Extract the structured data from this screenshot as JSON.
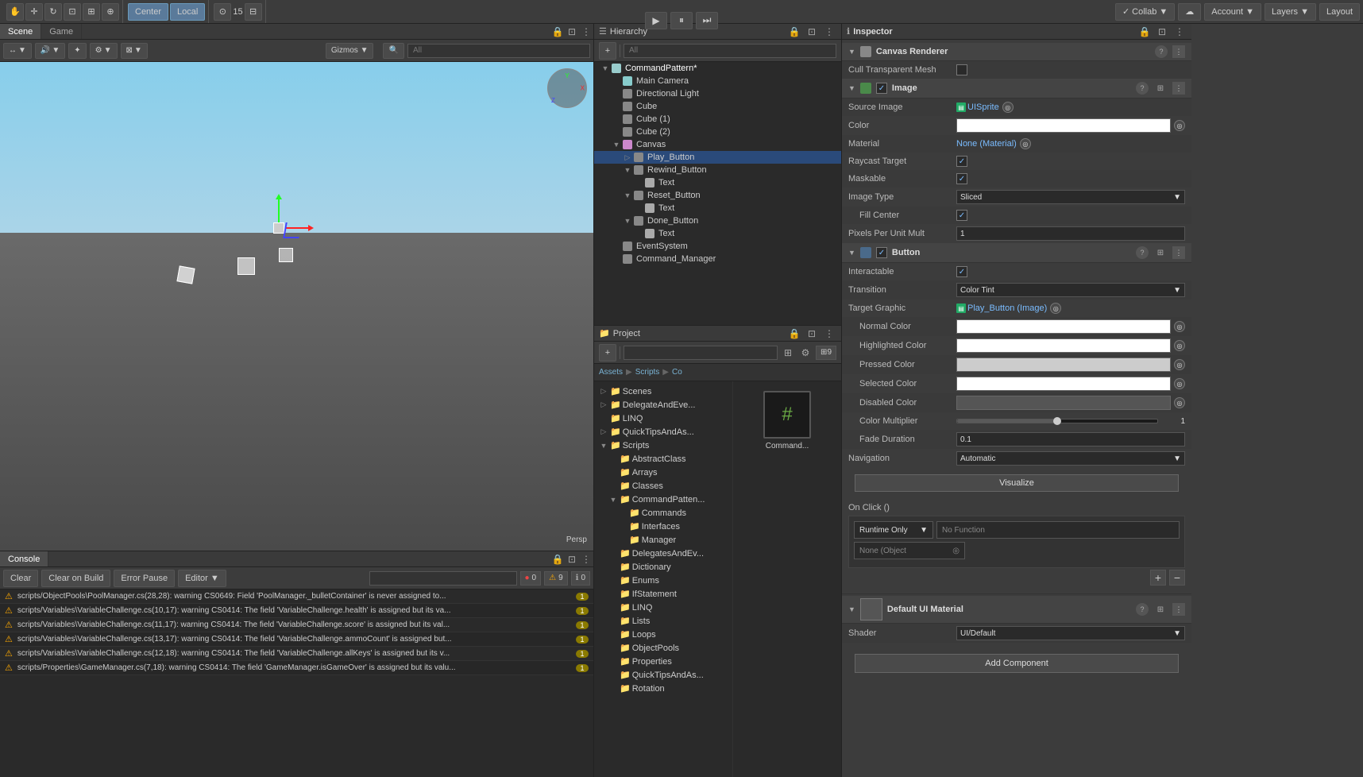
{
  "topbar": {
    "transform_center": "Center",
    "transform_mode": "Local",
    "snap_value": "15",
    "play_label": "Play",
    "pause_label": "Pause",
    "step_label": "Step",
    "collab_label": "Collab ▼",
    "cloud_label": "☁",
    "account_label": "Account ▼",
    "layers_label": "Layers ▼",
    "layout_label": "Layout"
  },
  "scene": {
    "tab_label": "Scene",
    "game_tab_label": "Game",
    "gizmos_label": "Gizmos ▼",
    "all_label": "All",
    "persp_label": "Persp",
    "toolbar_icons": [
      "⊕",
      "↔",
      "↻",
      "⊡",
      "⊞"
    ]
  },
  "hierarchy": {
    "title": "Hierarchy",
    "search_placeholder": "All",
    "items": [
      {
        "name": "CommandPattern*",
        "depth": 0,
        "arrow": "▼",
        "type": "scene",
        "modified": true
      },
      {
        "name": "Main Camera",
        "depth": 1,
        "arrow": "",
        "type": "camera"
      },
      {
        "name": "Directional Light",
        "depth": 1,
        "arrow": "",
        "type": "light"
      },
      {
        "name": "Cube",
        "depth": 1,
        "arrow": "",
        "type": "object"
      },
      {
        "name": "Cube (1)",
        "depth": 1,
        "arrow": "",
        "type": "object"
      },
      {
        "name": "Cube (2)",
        "depth": 1,
        "arrow": "",
        "type": "object"
      },
      {
        "name": "Canvas",
        "depth": 1,
        "arrow": "▼",
        "type": "canvas"
      },
      {
        "name": "Play_Button",
        "depth": 2,
        "arrow": "▷",
        "type": "object",
        "selected": true
      },
      {
        "name": "Rewind_Button",
        "depth": 2,
        "arrow": "▼",
        "type": "object"
      },
      {
        "name": "Text",
        "depth": 3,
        "arrow": "",
        "type": "text"
      },
      {
        "name": "Reset_Button",
        "depth": 2,
        "arrow": "▼",
        "type": "object"
      },
      {
        "name": "Text",
        "depth": 3,
        "arrow": "",
        "type": "text"
      },
      {
        "name": "Done_Button",
        "depth": 2,
        "arrow": "▼",
        "type": "object"
      },
      {
        "name": "Text",
        "depth": 3,
        "arrow": "",
        "type": "text"
      },
      {
        "name": "EventSystem",
        "depth": 1,
        "arrow": "",
        "type": "object"
      },
      {
        "name": "Command_Manager",
        "depth": 1,
        "arrow": "",
        "type": "object"
      }
    ]
  },
  "project": {
    "title": "Project",
    "search_placeholder": "",
    "path": {
      "assets": "Assets",
      "scripts": "Scripts",
      "co": "Co"
    },
    "folders": [
      {
        "name": "Scenes",
        "depth": 1,
        "arrow": "▷"
      },
      {
        "name": "DelegateAndEve...",
        "depth": 1,
        "arrow": "▷"
      },
      {
        "name": "LINQ",
        "depth": 1,
        "arrow": ""
      },
      {
        "name": "QuickTipsAndAs...",
        "depth": 1,
        "arrow": "▷"
      },
      {
        "name": "Scripts",
        "depth": 1,
        "arrow": "▼"
      },
      {
        "name": "AbstractClass",
        "depth": 2,
        "arrow": ""
      },
      {
        "name": "Arrays",
        "depth": 2,
        "arrow": ""
      },
      {
        "name": "Classes",
        "depth": 2,
        "arrow": ""
      },
      {
        "name": "CommandPatten...",
        "depth": 2,
        "arrow": "▼"
      },
      {
        "name": "Commands",
        "depth": 3,
        "arrow": ""
      },
      {
        "name": "Interfaces",
        "depth": 3,
        "arrow": ""
      },
      {
        "name": "Manager",
        "depth": 3,
        "arrow": ""
      },
      {
        "name": "DelegatesAndEv...",
        "depth": 2,
        "arrow": ""
      },
      {
        "name": "Dictionary",
        "depth": 2,
        "arrow": ""
      },
      {
        "name": "Enums",
        "depth": 2,
        "arrow": ""
      },
      {
        "name": "IfStatement",
        "depth": 2,
        "arrow": ""
      },
      {
        "name": "LINQ",
        "depth": 2,
        "arrow": ""
      },
      {
        "name": "Lists",
        "depth": 2,
        "arrow": ""
      },
      {
        "name": "Loops",
        "depth": 2,
        "arrow": ""
      },
      {
        "name": "ObjectPools",
        "depth": 2,
        "arrow": ""
      },
      {
        "name": "Properties",
        "depth": 2,
        "arrow": ""
      },
      {
        "name": "QuickTipsAndAs...",
        "depth": 2,
        "arrow": ""
      },
      {
        "name": "Rotation",
        "depth": 2,
        "arrow": ""
      }
    ],
    "asset_count": "9",
    "asset": {
      "icon": "#",
      "name": "Command..."
    }
  },
  "console": {
    "tab_label": "Console",
    "clear_label": "Clear",
    "clear_on_build": "Clear on Build",
    "error_pause": "Error Pause",
    "editor_label": "Editor ▼",
    "warning_count": "9",
    "error_count": "0",
    "messages": [
      {
        "text": "scripts/ObjectPools\\PoolManager.cs(28,28): warning CS0649: Field 'PoolManager._bulletContainer' is never assigned to...",
        "badge": "1",
        "type": "warning"
      },
      {
        "text": "scripts/Variables\\VariableChallenge.cs(10,17): warning CS0414: The field 'VariableChallenge.health' is assigned but its va...",
        "badge": "1",
        "type": "warning"
      },
      {
        "text": "scripts/Variables\\VariableChallenge.cs(11,17): warning CS0414: The field 'VariableChallenge.score' is assigned but its val...",
        "badge": "1",
        "type": "warning"
      },
      {
        "text": "scripts/Variables\\VariableChallenge.cs(13,17): warning CS0414: The field 'VariableChallenge.ammoCount' is assigned but...",
        "badge": "1",
        "type": "warning"
      },
      {
        "text": "scripts/Variables\\VariableChallenge.cs(12,18): warning CS0414: The field 'VariableChallenge.allKeys' is assigned but its v...",
        "badge": "1",
        "type": "warning"
      },
      {
        "text": "scripts/Properties\\GameManager.cs(7,18): warning CS0414: The field 'GameManager.isGameOver' is assigned but its valu...",
        "badge": "1",
        "type": "warning"
      }
    ]
  },
  "inspector": {
    "title": "Inspector",
    "canvas_renderer": {
      "label": "Canvas Renderer",
      "cull_mesh_label": "Cull Transparent Mesh",
      "cull_mesh_value": false
    },
    "image_component": {
      "label": "Image",
      "source_image_label": "Source Image",
      "source_image_value": "UISprite",
      "color_label": "Color",
      "material_label": "Material",
      "material_value": "None (Material)",
      "raycast_label": "Raycast Target",
      "raycast_value": true,
      "maskable_label": "Maskable",
      "maskable_value": true,
      "image_type_label": "Image Type",
      "image_type_value": "Sliced",
      "fill_center_label": "Fill Center",
      "fill_center_value": true,
      "ppu_label": "Pixels Per Unit Mult",
      "ppu_value": "1"
    },
    "button_component": {
      "label": "Button",
      "interactable_label": "Interactable",
      "interactable_value": true,
      "transition_label": "Transition",
      "transition_value": "Color Tint",
      "target_graphic_label": "Target Graphic",
      "target_graphic_value": "Play_Button (Image)",
      "normal_color_label": "Normal Color",
      "highlighted_color_label": "Highlighted Color",
      "pressed_color_label": "Pressed Color",
      "selected_color_label": "Selected Color",
      "disabled_color_label": "Disabled Color",
      "color_multiplier_label": "Color Multiplier",
      "color_multiplier_value": "1",
      "fade_duration_label": "Fade Duration",
      "fade_duration_value": "0.1",
      "navigation_label": "Navigation",
      "navigation_value": "Automatic",
      "visualize_label": "Visualize"
    },
    "onclick": {
      "label": "On Click ()",
      "runtime_label": "Runtime Only",
      "no_function_label": "No Function",
      "none_object_label": "None (Object"
    },
    "default_material": {
      "label": "Default UI Material",
      "shader_label": "Shader",
      "shader_value": "UI/Default"
    },
    "add_component_label": "Add Component"
  }
}
